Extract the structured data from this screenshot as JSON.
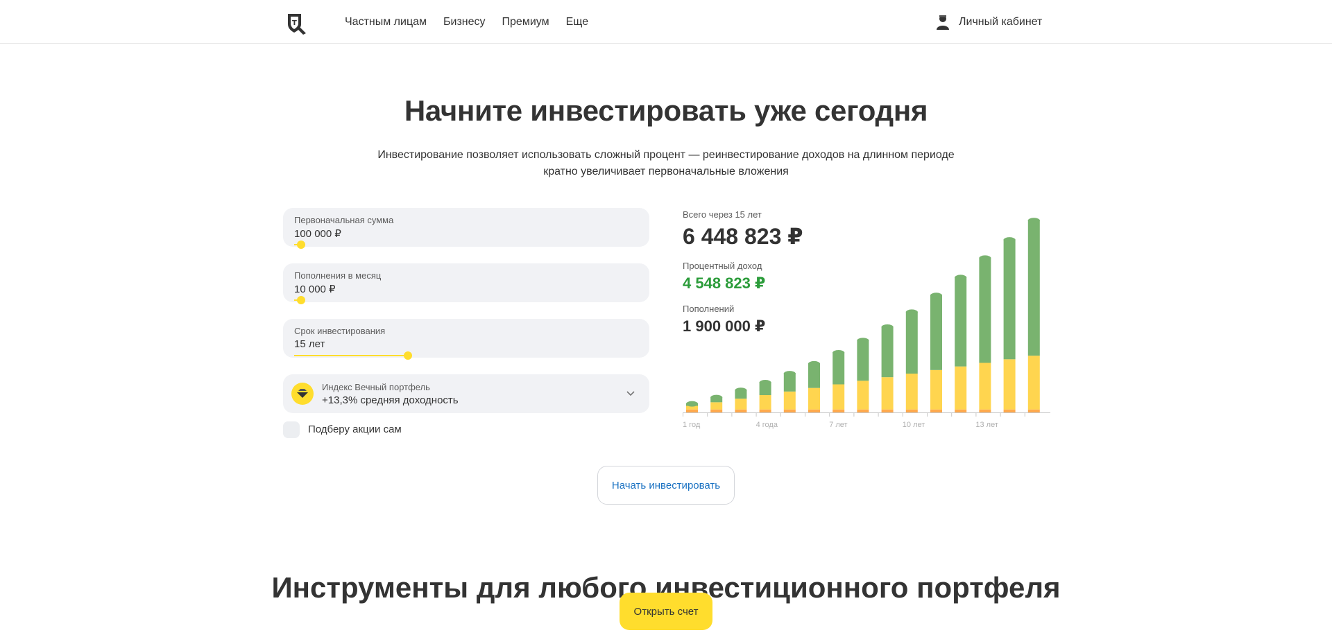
{
  "header": {
    "nav": [
      "Частным лицам",
      "Бизнесу",
      "Премиум",
      "Еще"
    ],
    "cabinet_label": "Личный кабинет"
  },
  "hero": {
    "title": "Начните инвестировать уже сегодня",
    "subtitle": "Инвестирование позволяет использовать сложный процент — реинвестирование доходов на длинном периоде кратно увеличивает первоначальные вложения"
  },
  "calculator": {
    "initial": {
      "label": "Первоначальная сумма",
      "value": "100 000 ₽",
      "slider_fraction": 0.02
    },
    "monthly": {
      "label": "Пополнения в месяц",
      "value": "10 000 ₽",
      "slider_fraction": 0.02
    },
    "term": {
      "label": "Срок инвестирования",
      "value": "15 лет",
      "slider_fraction": 0.33
    },
    "portfolio": {
      "name": "Индекс Вечный портфель",
      "yield": "+13,3% средняя доходность"
    },
    "self_pick_label": "Подберу акции сам"
  },
  "summary": {
    "total_label": "Всего через 15 лет",
    "total_value": "6 448 823 ₽",
    "income_label": "Процентный доход",
    "income_value": "4 548 823 ₽",
    "deposits_label": "Пополнений",
    "deposits_value": "1 900 000 ₽"
  },
  "colors": {
    "accent": "#ffdd2d",
    "income_green": "#2b9c3a",
    "bar_green": "#79b36f",
    "bar_yellow": "#ffd54f",
    "bar_orange": "#ffa94d",
    "link_blue": "#1971c2"
  },
  "chart_data": {
    "type": "bar",
    "stacked": true,
    "categories": [
      "1",
      "2",
      "3",
      "4",
      "5",
      "6",
      "7",
      "8",
      "9",
      "10",
      "11",
      "12",
      "13",
      "14",
      "15"
    ],
    "x_tick_labels": [
      "1 год",
      "4 года",
      "7 лет",
      "10 лет",
      "13 лет"
    ],
    "series": [
      {
        "name": "",
        "values": [
          100000,
          100000,
          100000,
          100000,
          100000,
          100000,
          100000,
          100000,
          100000,
          100000,
          100000,
          100000,
          100000,
          100000,
          100000
        ]
      },
      {
        "name": "",
        "values": [
          120000,
          240000,
          360000,
          480000,
          600000,
          720000,
          840000,
          960000,
          1080000,
          1200000,
          1320000,
          1440000,
          1560000,
          1680000,
          1800000
        ]
      },
      {
        "name": "",
        "values": [
          90000,
          180000,
          300000,
          440000,
          620000,
          830000,
          1080000,
          1370000,
          1700000,
          2080000,
          2520000,
          3000000,
          3530000,
          4020000,
          4548823
        ]
      }
    ],
    "ylim": [
      0,
      6500000
    ]
  },
  "cta": {
    "start_label": "Начать инвестировать"
  },
  "section2": {
    "title": "Инструменты для любого инвестиционного портфеля"
  },
  "floating": {
    "open_label": "Открыть счет"
  }
}
